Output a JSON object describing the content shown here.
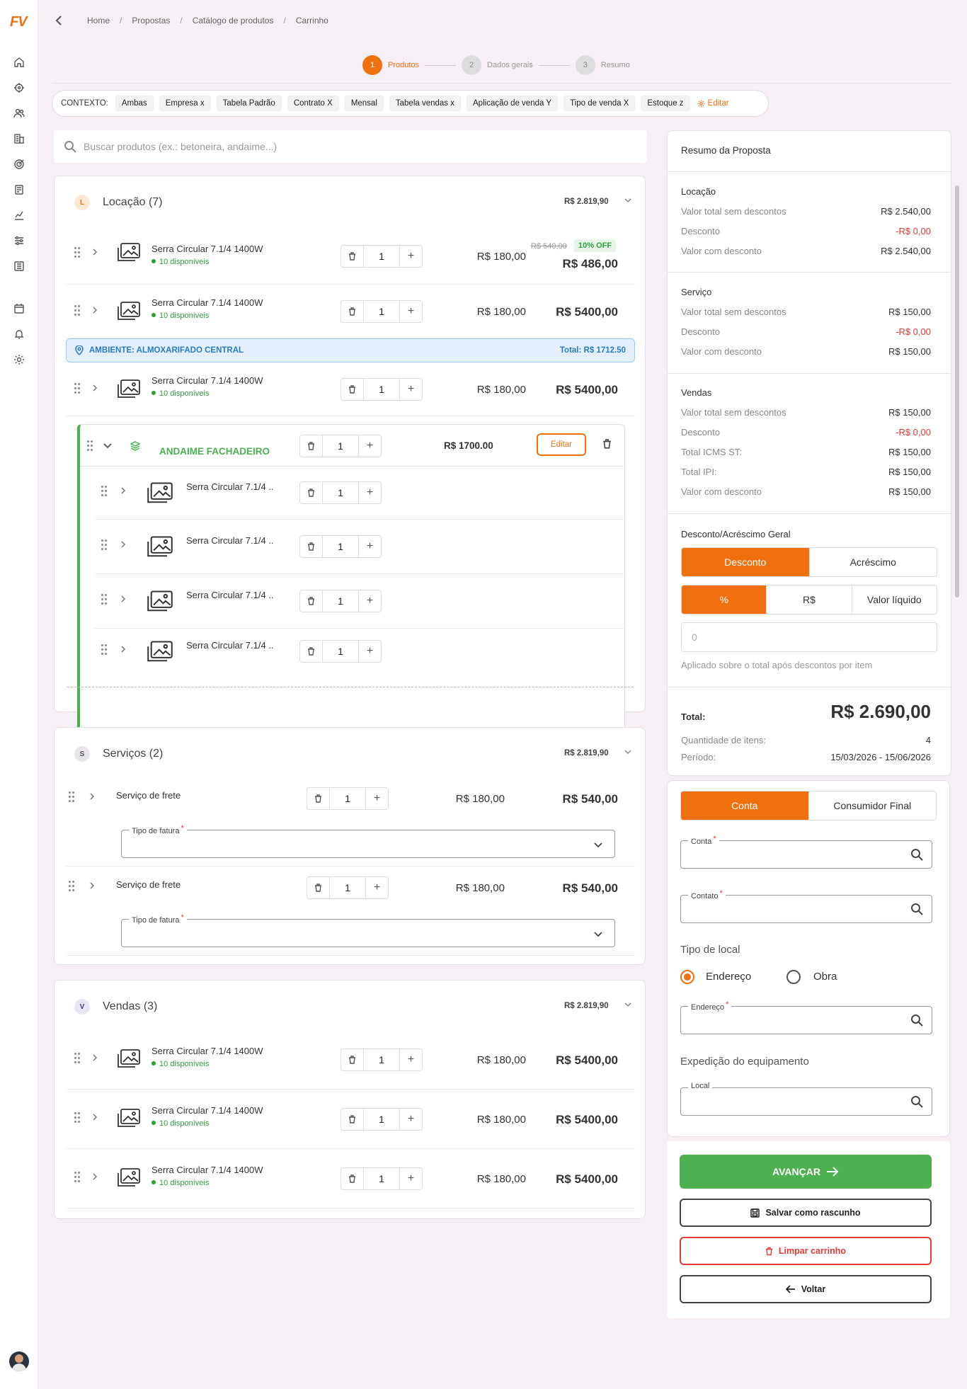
{
  "app": {
    "logo": "FV"
  },
  "breadcrumb": [
    "Home",
    "Propostas",
    "Catálogo de produtos",
    "Carrinho"
  ],
  "steps": [
    {
      "num": "1",
      "label": "Produtos"
    },
    {
      "num": "2",
      "label": "Dados gerais"
    },
    {
      "num": "3",
      "label": "Resumo"
    }
  ],
  "context": {
    "label": "CONTEXTO:",
    "chips": [
      "Ambas",
      "Empresa x",
      "Tabela Padrão",
      "Contrato X",
      "Mensal",
      "Tabela vendas x",
      "Aplicação de venda Y",
      "Tipo  de venda X",
      "Estoque z"
    ],
    "edit_label": "Editar"
  },
  "search": {
    "placeholder": "Buscar produtos (ex.: betoneira, andaime...)"
  },
  "locacao": {
    "badge": "L",
    "title": "Locação (7)",
    "total": "R$ 2.819,90",
    "items": [
      {
        "name": "Serra Circular 7.1/4 1400W",
        "avail": "10 disponíveis",
        "qty": "1",
        "unit": "R$ 180,00",
        "old": "R$ 540,00",
        "off": "10% OFF",
        "total": "R$ 486,00"
      },
      {
        "name": "Serra Circular 7.1/4 1400W",
        "avail": "10 disponíveis",
        "qty": "1",
        "unit": "R$ 180,00",
        "total": "R$ 5400,00"
      },
      {
        "name": "Serra Circular 7.1/4 1400W",
        "avail": "10 disponíveis",
        "qty": "1",
        "unit": "R$ 180,00",
        "total": "R$ 5400,00"
      }
    ],
    "ambiente": {
      "label": "AMBIENTE: ALMOXARIFADO CENTRAL",
      "total": "Total: R$ 1712.50"
    },
    "kit": {
      "name": "ANDAIME FACHADEIRO",
      "qty": "1",
      "total": "R$ 1700.00",
      "edit_label": "Editar",
      "items": [
        {
          "name": "Serra Circular 7.1/4 ..",
          "qty": "1"
        },
        {
          "name": "Serra Circular 7.1/4 ..",
          "qty": "1"
        },
        {
          "name": "Serra Circular 7.1/4 ..",
          "qty": "1"
        },
        {
          "name": "Serra Circular 7.1/4 ..",
          "qty": "1"
        }
      ]
    }
  },
  "servicos": {
    "badge": "S",
    "title": "Serviços (2)",
    "total": "R$ 2.819,90",
    "items": [
      {
        "name": "Serviço de frete",
        "qty": "1",
        "unit": "R$ 180,00",
        "total": "R$ 540,00",
        "field_label": "Tipo de fatura"
      },
      {
        "name": "Serviço de frete",
        "qty": "1",
        "unit": "R$ 180,00",
        "total": "R$ 540,00",
        "field_label": "Tipo de fatura"
      }
    ]
  },
  "vendas": {
    "badge": "V",
    "title": "Vendas (3)",
    "total": "R$ 2.819,90",
    "items": [
      {
        "name": "Serra Circular 7.1/4 1400W",
        "avail": "10 disponíveis",
        "qty": "1",
        "unit": "R$ 180,00",
        "total": "R$ 5400,00"
      },
      {
        "name": "Serra Circular 7.1/4 1400W",
        "avail": "10 disponíveis",
        "qty": "1",
        "unit": "R$ 180,00",
        "total": "R$ 5400,00"
      },
      {
        "name": "Serra Circular 7.1/4 1400W",
        "avail": "10 disponíveis",
        "qty": "1",
        "unit": "R$ 180,00",
        "total": "R$ 5400,00"
      }
    ]
  },
  "summary": {
    "title": "Resumo da Proposta",
    "locacao": {
      "head": "Locação",
      "rows": [
        {
          "label": "Valor total sem descontos",
          "value": "R$ 2.540,00"
        },
        {
          "label": "Desconto",
          "value": "-R$ 0,00"
        },
        {
          "label": "Valor com desconto",
          "value": "R$ 2.540,00"
        }
      ]
    },
    "servico": {
      "head": "Serviço",
      "rows": [
        {
          "label": "Valor total sem descontos",
          "value": "R$ 150,00"
        },
        {
          "label": "Desconto",
          "value": "-R$ 0,00"
        },
        {
          "label": "Valor com desconto",
          "value": "R$ 150,00"
        }
      ]
    },
    "vendas": {
      "head": "Vendas",
      "rows": [
        {
          "label": "Valor total sem descontos",
          "value": "R$ 150,00"
        },
        {
          "label": "Desconto",
          "value": "-R$ 0,00"
        },
        {
          "label": "Total ICMS ST:",
          "value": "R$ 150,00"
        },
        {
          "label": "Total IPI:",
          "value": "R$ 150,00"
        },
        {
          "label": "Valor com desconto",
          "value": "R$ 150,00"
        }
      ]
    },
    "discount": {
      "head": "Desconto/Acréscimo Geral",
      "mode": [
        "Desconto",
        "Acréscimo"
      ],
      "unit": [
        "%",
        "R$",
        "Valor líquido"
      ],
      "placeholder": "0",
      "hint": "Aplicado sobre o total após descontos por item"
    },
    "total_label": "Total:",
    "total_value": "R$ 2.690,00",
    "qty_label": "Quantidade de itens:",
    "qty_value": "4",
    "period_label": "Período:",
    "period_value": "15/03/2026 - 15/06/2026"
  },
  "client": {
    "tabs": [
      "Conta",
      "Consumidor Final"
    ],
    "conta_label": "Conta",
    "contato_label": "Contato",
    "local_type_label": "Tipo de local",
    "radio": [
      "Endereço",
      "Obra"
    ],
    "endereco_label": "Endereço",
    "expedicao_label": "Expedição do equipamento",
    "local_label": "Local"
  },
  "actions": {
    "next": "AVANÇAR",
    "draft": "Salvar como rascunho",
    "clear": "Limpar carrinho",
    "back": "Voltar"
  },
  "colors": {
    "accent": "#f07010",
    "success": "#4caf50",
    "danger": "#e53935",
    "info": "#2a7bc4"
  }
}
